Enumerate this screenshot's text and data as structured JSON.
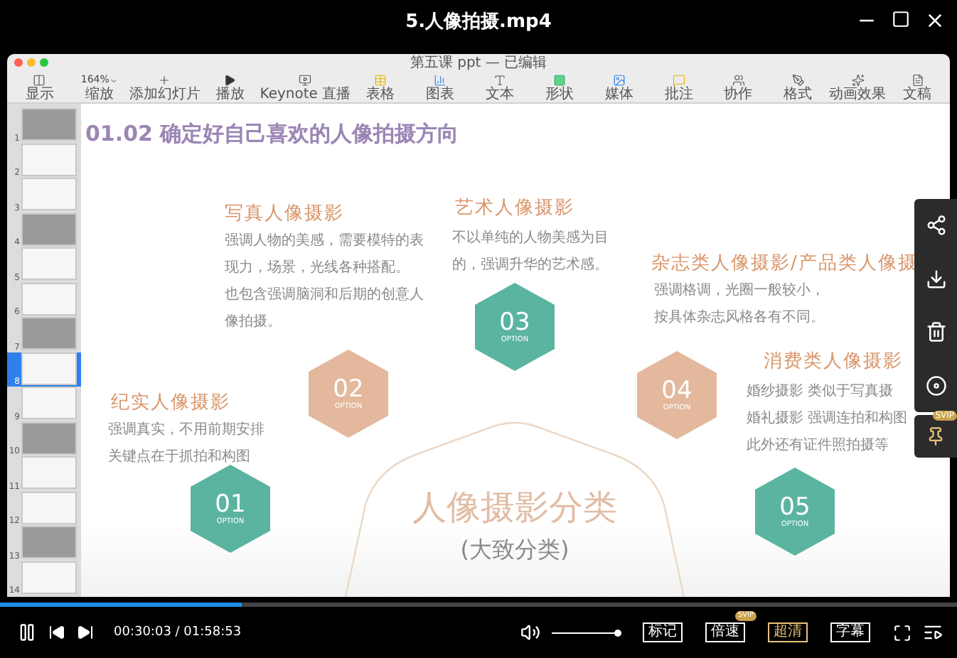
{
  "player": {
    "title": "5.人像拍摄.mp4"
  },
  "keynote": {
    "document_title": "第五课 ppt — 已编辑",
    "zoom_value": "164%",
    "toolbar": [
      {
        "kind": "view",
        "label": "显示"
      },
      {
        "kind": "zoom",
        "label": "缩放"
      },
      {
        "kind": "add",
        "label": "添加幻灯片"
      },
      {
        "kind": "play",
        "label": "播放"
      },
      {
        "kind": "live",
        "label": "Keynote 直播"
      },
      {
        "kind": "table",
        "label": "表格"
      },
      {
        "kind": "chart",
        "label": "图表"
      },
      {
        "kind": "text",
        "label": "文本"
      },
      {
        "kind": "shape",
        "label": "形状"
      },
      {
        "kind": "media",
        "label": "媒体"
      },
      {
        "kind": "comment",
        "label": "批注"
      },
      {
        "kind": "collab",
        "label": "协作"
      },
      {
        "kind": "format",
        "label": "格式"
      },
      {
        "kind": "animate",
        "label": "动画效果"
      },
      {
        "kind": "document",
        "label": "文稿"
      }
    ],
    "thumbnails": [
      {
        "number": "1",
        "selected": false
      },
      {
        "number": "2",
        "selected": false
      },
      {
        "number": "3",
        "selected": false
      },
      {
        "number": "4",
        "selected": false
      },
      {
        "number": "5",
        "selected": false
      },
      {
        "number": "6",
        "selected": false
      },
      {
        "number": "7",
        "selected": false
      },
      {
        "number": "8",
        "selected": true
      },
      {
        "number": "9",
        "selected": false
      },
      {
        "number": "10",
        "selected": false
      },
      {
        "number": "11",
        "selected": false
      },
      {
        "number": "12",
        "selected": false
      },
      {
        "number": "13",
        "selected": false
      },
      {
        "number": "14",
        "selected": false
      }
    ]
  },
  "slide": {
    "heading": "01.02 确定好自己喜欢的人像拍摄方向",
    "center_title": "人像摄影分类",
    "center_subtitle": "(大致分类)",
    "categories": [
      {
        "title": "纪实人像摄影",
        "lines": [
          "强调真实，不用前期安排",
          "关键点在于抓拍和构图"
        ],
        "number": "01",
        "tag": "OPTION",
        "color": "#5ab4a0"
      },
      {
        "title": "写真人像摄影",
        "lines": [
          "强调人物的美感，需要模特的表",
          "现力，场景，光线各种搭配。",
          "也包含强调脑洞和后期的创意人",
          "像拍摄。"
        ],
        "number": "02",
        "tag": "OPTION",
        "color": "#e3b89c"
      },
      {
        "title": "艺术人像摄影",
        "lines": [
          "不以单纯的人物美感为目",
          "的，强调升华的艺术感。"
        ],
        "number": "03",
        "tag": "OPTION",
        "color": "#5ab4a0"
      },
      {
        "title": "杂志类人像摄影/产品类人像摄",
        "lines": [
          "强调格调，光圈一般较小，",
          "按具体杂志风格各有不同。"
        ],
        "number": "04",
        "tag": "OPTION",
        "color": "#e3b89c"
      },
      {
        "title": "消费类人像摄影",
        "lines": [
          "婚纱摄影 类似于写真摄",
          "婚礼摄影 强调连拍和构图",
          "此外还有证件照拍摄等"
        ],
        "number": "05",
        "tag": "OPTION",
        "color": "#5ab4a0"
      }
    ]
  },
  "side_panel": {
    "badge": "SVIP"
  },
  "progress": {
    "level": 0.253
  },
  "controls": {
    "time": "00:30:03 / 01:58:53",
    "volume": {
      "level": 1.0
    },
    "buttons": [
      {
        "label": "标记",
        "selected": false
      },
      {
        "label": "倍速",
        "selected": false,
        "badge": "SVIP"
      },
      {
        "label": "超清",
        "selected": true
      },
      {
        "label": "字幕",
        "selected": false
      }
    ]
  }
}
